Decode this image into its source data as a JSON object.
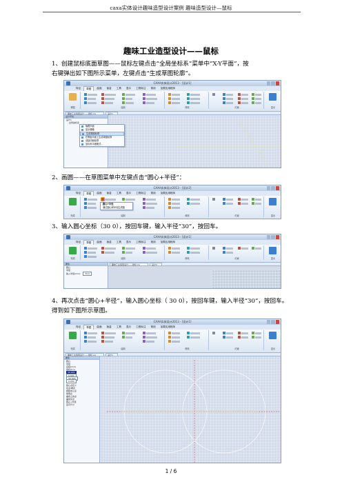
{
  "doc": {
    "header": "caxa实体设计趣味造型设计案例 趣味造型设计—鼠标",
    "title": "趣味工业造型设计——鼠标",
    "step1_line1": "1、创建鼠标底面草图——鼠标左键点击“全局坐标系”菜单中“X-Y平面”，按",
    "step1_line2": "右键弹出如下图所示菜单，左键点击“生成草图轮廓”。",
    "step2": "2、画圆——在草图菜单中左键点击“圆心+半径”：",
    "step3": "3、输入圆心坐标（30 0），按回车键，输入半径“30”，按回车。",
    "step4_line1": "4、再次点击“圆心+半径”，输入圆心坐标（ 30 0），按回车键，输入半径“30”，按回车。",
    "step4_line2": "得到如下图所示草图。",
    "page_number": "1 / 6"
  },
  "app": {
    "title": "CAXA实体设计2013 - [设计1]",
    "title_short": "CAXA实体设计2013 - [设计2]",
    "tabs": [
      "特征",
      "草图",
      "曲面",
      "钣金",
      "工具",
      "显示",
      "工程标注",
      "常用",
      "加载应用程序"
    ],
    "groups": [
      "草图",
      "绘制",
      "修改",
      "约束",
      "显示"
    ],
    "design_tab": "设计1",
    "design_tab2": "设计2",
    "subtab": "趣味工业造型设计——鼠标.ics",
    "tree_title": "设计环境",
    "tree_root": "设计1",
    "tree_child": "全局坐标系",
    "context_menu": [
      "隐藏平面",
      "显示栅格",
      "生成草图轮廓",
      "在等距平面上生成草图轮廓",
      "创建切面轮廓",
      "坐标系平面格式..."
    ],
    "tooltip": [
      "圆心+半径",
      "通过圆心和半径生成圆"
    ],
    "props_title": "属性",
    "props_rows": [
      "圆心",
      "半径",
      "输入半径(mm):",
      "30.0"
    ],
    "props_rows2": [
      "圆心",
      "半径",
      "直径(mm)",
      "坐标(X,Y)",
      "30.000",
      "0.000",
      "30.000",
      "0.000"
    ],
    "list_items": [
      "圆心点定义",
      "切点/端点",
      "圆弧中心点",
      "象限点",
      "曲线上的点",
      "曲线交点",
      "圆心+半径",
      "显示尺寸"
    ],
    "finish_label": "完成"
  }
}
